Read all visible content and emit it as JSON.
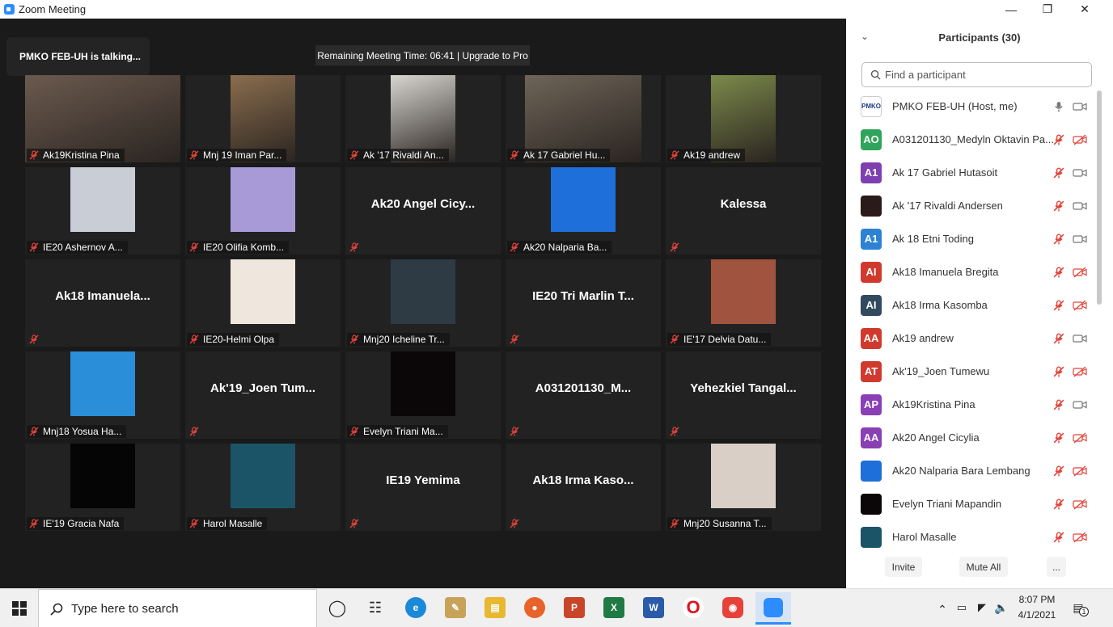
{
  "window": {
    "title": "Zoom Meeting"
  },
  "banner": {
    "talking": "PMKO FEB-UH is talking...",
    "remaining": "Remaining Meeting Time: 06:41 | Upgrade to Pro"
  },
  "tiles": [
    {
      "label": "Ak19Kristina Pina",
      "kind": "video",
      "color": "#6b5a4f"
    },
    {
      "label": "Mnj 19 Iman Par...",
      "kind": "video",
      "color": "#8a6d4e"
    },
    {
      "label": "Ak '17 Rivaldi An...",
      "kind": "video",
      "color": "#d8d6d2"
    },
    {
      "label": "Ak 17 Gabriel Hu...",
      "kind": "video",
      "color": "#6e6458"
    },
    {
      "label": "Ak19 andrew",
      "kind": "video",
      "color": "#7c8a4a"
    },
    {
      "label": "IE20 Ashernov A...",
      "kind": "photo",
      "color": "#c8cdd6"
    },
    {
      "label": "IE20 Olifia Komb...",
      "kind": "photo",
      "color": "#a89ad6"
    },
    {
      "label": "",
      "big": "Ak20  Angel  Cicy...",
      "kind": "name"
    },
    {
      "label": "Ak20 Nalparia Ba...",
      "kind": "photo",
      "color": "#1e6fd9"
    },
    {
      "label": "",
      "big": "Kalessa",
      "kind": "name"
    },
    {
      "label": "",
      "big": "Ak18  Imanuela...",
      "kind": "name"
    },
    {
      "label": "IE20-Helmi Olpa",
      "kind": "photo",
      "color": "#efe6de"
    },
    {
      "label": "Mnj20 Icheline Tr...",
      "kind": "photo",
      "color": "#2e3a44"
    },
    {
      "label": "",
      "big": "IE20 Tri Marlin T...",
      "kind": "name"
    },
    {
      "label": "IE'17 Delvia Datu...",
      "kind": "photo",
      "color": "#a0533e"
    },
    {
      "label": "Mnj18 Yosua Ha...",
      "kind": "photo",
      "color": "#2a8fd8"
    },
    {
      "label": "",
      "big": "Ak'19_Joen  Tum...",
      "kind": "name"
    },
    {
      "label": "Evelyn Triani Ma...",
      "kind": "photo",
      "color": "#0b0708"
    },
    {
      "label": "",
      "big": "A031201130_M...",
      "kind": "name"
    },
    {
      "label": "",
      "big": "Yehezkiel  Tangal...",
      "kind": "name"
    },
    {
      "label": "IE'19 Gracia Nafa",
      "kind": "photo",
      "color": "#050505"
    },
    {
      "label": "Harol Masalle",
      "kind": "photo",
      "color": "#1b5466"
    },
    {
      "label": "",
      "big": "IE19 Yemima",
      "kind": "name"
    },
    {
      "label": "",
      "big": "Ak18  Irma  Kaso...",
      "kind": "name"
    },
    {
      "label": "Mnj20 Susanna T...",
      "kind": "photo",
      "color": "#d9cfc6"
    }
  ],
  "panel": {
    "title": "Participants (30)",
    "search_placeholder": "Find a participant",
    "invite": "Invite",
    "mute_all": "Mute All",
    "more": "...",
    "participants": [
      {
        "initials": "",
        "name": "PMKO FEB-UH (Host, me)",
        "color": "#ffffff",
        "logo": "PMKO",
        "mic": "on",
        "cam": "on"
      },
      {
        "initials": "AO",
        "name": "A031201130_Medyln Oktavin Pa...",
        "color": "#2ea55a",
        "mic": "off",
        "cam": "off"
      },
      {
        "initials": "A1",
        "name": "Ak 17 Gabriel Hutasoit",
        "color": "#7e3fb0",
        "mic": "off",
        "cam": "on"
      },
      {
        "initials": "",
        "name": "Ak '17 Rivaldi Andersen",
        "color": "#2a1a1a",
        "mic": "off",
        "cam": "on"
      },
      {
        "initials": "A1",
        "name": "Ak 18 Etni Toding",
        "color": "#2d82d4",
        "mic": "off",
        "cam": "on"
      },
      {
        "initials": "AI",
        "name": "Ak18 Imanuela Bregita",
        "color": "#d03a2e",
        "mic": "off",
        "cam": "off"
      },
      {
        "initials": "AI",
        "name": "Ak18 Irma Kasomba",
        "color": "#324a5e",
        "mic": "off",
        "cam": "off"
      },
      {
        "initials": "AA",
        "name": "Ak19 andrew",
        "color": "#d03a2e",
        "mic": "off",
        "cam": "on"
      },
      {
        "initials": "AT",
        "name": "Ak'19_Joen Tumewu",
        "color": "#d03a2e",
        "mic": "off",
        "cam": "off"
      },
      {
        "initials": "AP",
        "name": "Ak19Kristina Pina",
        "color": "#8a3fb5",
        "mic": "off",
        "cam": "on"
      },
      {
        "initials": "AA",
        "name": "Ak20 Angel Cicylia",
        "color": "#8a3fb5",
        "mic": "off",
        "cam": "off"
      },
      {
        "initials": "",
        "name": "Ak20 Nalparia Bara Lembang",
        "color": "#1e6fd9",
        "mic": "off",
        "cam": "off"
      },
      {
        "initials": "",
        "name": "Evelyn Triani Mapandin",
        "color": "#0b0708",
        "mic": "off",
        "cam": "off"
      },
      {
        "initials": "",
        "name": "Harol Masalle",
        "color": "#1b5466",
        "mic": "off",
        "cam": "off"
      }
    ]
  },
  "taskbar": {
    "search": "Type here to search",
    "time": "8:07 PM",
    "date": "4/1/2021",
    "notifications": "1"
  }
}
